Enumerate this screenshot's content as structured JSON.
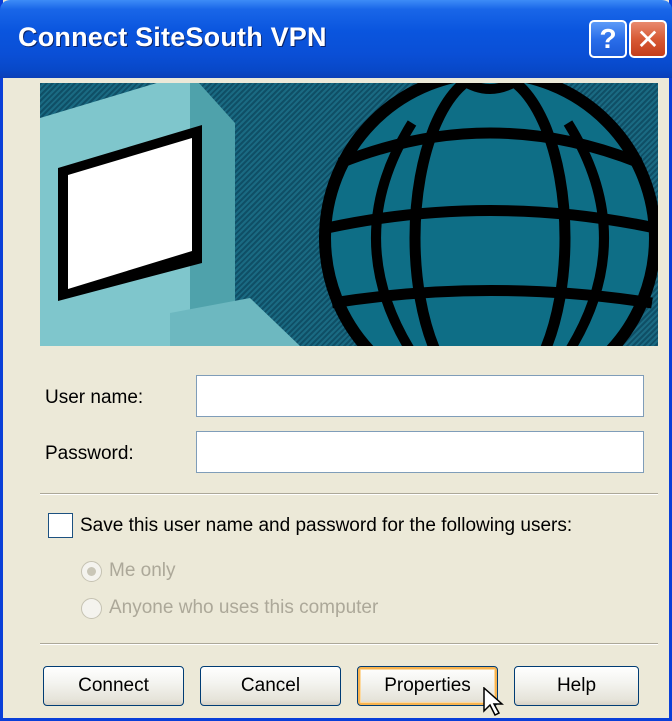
{
  "window": {
    "title": "Connect SiteSouth VPN",
    "help_glyph": "?",
    "close_glyph": "✕"
  },
  "banner": {
    "icons": [
      "computer-monitor-icon",
      "globe-icon"
    ],
    "colors": {
      "background": "#1A6A82",
      "monitor": "#7FC6CC",
      "globe_fill": "#0E6E86"
    }
  },
  "form": {
    "username_label": "User name:",
    "username_value": "",
    "password_label": "Password:",
    "password_value": "",
    "save_checkbox_label": "Save this user name and password for the following users:",
    "save_checked": false,
    "radio_me_only": "Me only",
    "radio_anyone": "Anyone who uses this computer",
    "radio_selected": "Me only"
  },
  "buttons": {
    "connect": "Connect",
    "cancel": "Cancel",
    "properties": "Properties",
    "help": "Help"
  },
  "colors": {
    "title_bar": "#0A55DE",
    "dialog_bg": "#ECE9D8",
    "close_red": "#D85A35",
    "focus_orange": "#F8B34F"
  }
}
